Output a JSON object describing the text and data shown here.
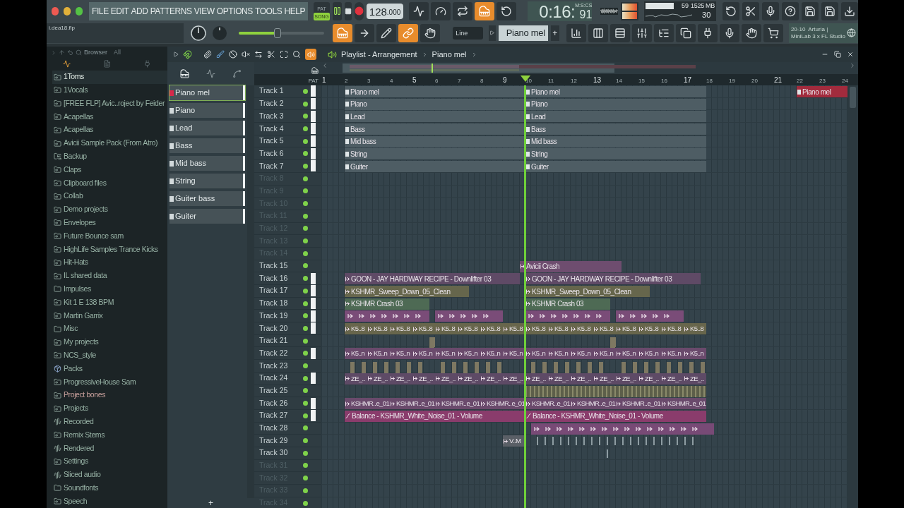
{
  "menu": [
    "FILE",
    "EDIT",
    "ADD",
    "PATTERNS",
    "VIEW",
    "OPTIONS",
    "TOOLS",
    "HELP"
  ],
  "transport": {
    "modes": [
      {
        "label": "PAT",
        "selected": false
      },
      {
        "label": "SONG",
        "selected": true
      }
    ],
    "tempo": "128",
    "tempo_fraction": ".000"
  },
  "time": {
    "main": "0:16:",
    "centiseconds": "91",
    "format": "M:S:CS"
  },
  "monitor": {
    "cpu": "59",
    "memory": "1525 MB",
    "polyphony": "30"
  },
  "hint": {
    "line1": "20-10  Arturia |",
    "line2": "MiniLab 3 x FL Studio"
  },
  "project_file": "i.dea18.flp",
  "master_volume": {
    "level": 0.45
  },
  "snap": "Line",
  "pattern": "Piano mel",
  "pattern_add": "+",
  "browser": {
    "title": "Browser",
    "filter": "All",
    "items": [
      {
        "label": "1Toms",
        "kind": "folder",
        "selected": true
      },
      {
        "label": "1Vocals",
        "kind": "folder",
        "selected": false
      },
      {
        "label": "[FREE FLP] Avic..roject by Feider",
        "kind": "folder",
        "selected": false
      },
      {
        "label": "Acapellas",
        "kind": "folder",
        "selected": false
      },
      {
        "label": "Acapellas",
        "kind": "folder",
        "selected": false
      },
      {
        "label": "Avicii Sample Pack (From Atro)",
        "kind": "folder",
        "selected": false
      },
      {
        "label": "Backup",
        "kind": "backup",
        "selected": false
      },
      {
        "label": "Claps",
        "kind": "folder",
        "selected": false
      },
      {
        "label": "Clipboard files",
        "kind": "folder",
        "selected": false
      },
      {
        "label": "Collab",
        "kind": "folder",
        "selected": false
      },
      {
        "label": "Demo projects",
        "kind": "folder",
        "selected": false
      },
      {
        "label": "Envelopes",
        "kind": "folder",
        "selected": false
      },
      {
        "label": "Future Bounce sam",
        "kind": "folder",
        "selected": false
      },
      {
        "label": "HighLife Samples Trance Kicks",
        "kind": "folder",
        "selected": false
      },
      {
        "label": "Hit-Hats",
        "kind": "folder",
        "selected": false
      },
      {
        "label": "IL shared data",
        "kind": "folder",
        "selected": false
      },
      {
        "label": "Impulses",
        "kind": "plain",
        "selected": false
      },
      {
        "label": "Kit 1 E 138 BPM",
        "kind": "folder",
        "selected": false
      },
      {
        "label": "Martin Garrix",
        "kind": "folder",
        "selected": false
      },
      {
        "label": "Misc",
        "kind": "plain",
        "selected": false
      },
      {
        "label": "My projects",
        "kind": "folder",
        "selected": false
      },
      {
        "label": "NCS_style",
        "kind": "folder",
        "selected": false
      },
      {
        "label": "Packs",
        "kind": "packs",
        "selected": false
      },
      {
        "label": "ProgressiveHouse Sam",
        "kind": "folder",
        "selected": false
      },
      {
        "label": "Project bones",
        "kind": "folder",
        "selected": false,
        "color": "#c8a09c"
      },
      {
        "label": "Projects",
        "kind": "folder",
        "selected": false
      },
      {
        "label": "Recorded",
        "kind": "audio",
        "selected": false
      },
      {
        "label": "Remix Stems",
        "kind": "folder",
        "selected": false
      },
      {
        "label": "Rendered",
        "kind": "audio",
        "selected": false
      },
      {
        "label": "Settings",
        "kind": "folder",
        "selected": false
      },
      {
        "label": "Sliced audio",
        "kind": "audio",
        "selected": false
      },
      {
        "label": "Soundfonts",
        "kind": "plain",
        "selected": false
      },
      {
        "label": "Speech",
        "kind": "folder",
        "selected": false
      }
    ]
  },
  "channels": {
    "items": [
      {
        "label": "Piano mel",
        "selected": true
      },
      {
        "label": "Piano",
        "selected": false
      },
      {
        "label": "Lead",
        "selected": false
      },
      {
        "label": "Bass",
        "selected": false
      },
      {
        "label": "Mid bass",
        "selected": false
      },
      {
        "label": "String",
        "selected": false
      },
      {
        "label": "Guiter bass",
        "selected": false
      },
      {
        "label": "Guiter",
        "selected": false
      }
    ],
    "add": "+"
  },
  "playlist": {
    "title": "Playlist - Arrangement",
    "pattern": "Piano mel",
    "pat_label": "PAT",
    "ruler": [
      "1",
      "2",
      "3",
      "4",
      "5",
      "6",
      "7",
      "8",
      "9",
      "10",
      "11",
      "12",
      "13",
      "14",
      "15",
      "16",
      "17",
      "18",
      "19",
      "20",
      "21",
      "22",
      "23",
      "24"
    ],
    "tracks": [
      {
        "name": "Track 1",
        "dimmed": false,
        "marked": true,
        "clips": [
          {
            "kind": "pattern",
            "label": "Piano mel",
            "color": "#4e5d64"
          },
          {
            "kind": "pattern",
            "label": "Piano mel",
            "color": "#4e5d64"
          },
          {
            "kind": "pattern",
            "label": "Piano mel",
            "color": "#a22b3d"
          }
        ]
      },
      {
        "name": "Track 2",
        "dimmed": false,
        "marked": true,
        "clips": [
          {
            "kind": "pattern",
            "label": "Piano",
            "color": "#4e5d64"
          },
          {
            "kind": "pattern",
            "label": "Piano",
            "color": "#4e5d64"
          }
        ]
      },
      {
        "name": "Track 3",
        "dimmed": false,
        "marked": true,
        "clips": [
          {
            "kind": "pattern",
            "label": "Lead",
            "color": "#4e5d64"
          },
          {
            "kind": "pattern",
            "label": "Lead",
            "color": "#4e5d64"
          }
        ]
      },
      {
        "name": "Track 4",
        "dimmed": false,
        "marked": true,
        "clips": [
          {
            "kind": "pattern",
            "label": "Bass",
            "color": "#4e5d64"
          },
          {
            "kind": "pattern",
            "label": "Bass",
            "color": "#4e5d64"
          }
        ]
      },
      {
        "name": "Track 5",
        "dimmed": false,
        "marked": true,
        "clips": [
          {
            "kind": "pattern",
            "label": "Mid bass",
            "color": "#4e5d64"
          },
          {
            "kind": "pattern",
            "label": "Mid bass",
            "color": "#4e5d64"
          }
        ]
      },
      {
        "name": "Track 6",
        "dimmed": false,
        "marked": true,
        "clips": [
          {
            "kind": "pattern",
            "label": "String",
            "color": "#4e5d64"
          },
          {
            "kind": "pattern",
            "label": "String",
            "color": "#4e5d64"
          }
        ]
      },
      {
        "name": "Track 7",
        "dimmed": false,
        "marked": true,
        "clips": [
          {
            "kind": "pattern",
            "label": "Guiter",
            "color": "#4e5d64"
          },
          {
            "kind": "pattern",
            "label": "Guiter",
            "color": "#4e5d64"
          }
        ]
      },
      {
        "name": "Track 8",
        "dimmed": true,
        "marked": false
      },
      {
        "name": "Track 9",
        "dimmed": true,
        "marked": false
      },
      {
        "name": "Track 10",
        "dimmed": true,
        "marked": false
      },
      {
        "name": "Track 11",
        "dimmed": true,
        "marked": false
      },
      {
        "name": "Track 12",
        "dimmed": true,
        "marked": false
      },
      {
        "name": "Track 13",
        "dimmed": true,
        "marked": false
      },
      {
        "name": "Track 14",
        "dimmed": true,
        "marked": false
      },
      {
        "name": "Track 15",
        "dimmed": false,
        "marked": false,
        "clips": [
          {
            "kind": "audio",
            "label": "Avicii Crash",
            "color": "#6e4d6f"
          }
        ]
      },
      {
        "name": "Track 16",
        "dimmed": false,
        "marked": true,
        "clips": [
          {
            "kind": "audio",
            "label": "GOON - JAY HARDWAY RECIPE - Downlifter 03",
            "color": "#5f4a66"
          },
          {
            "kind": "audio",
            "label": "GOON - JAY HARDWAY RECIPE - Downlifter 03",
            "color": "#5f4a66"
          }
        ]
      },
      {
        "name": "Track 17",
        "dimmed": false,
        "marked": true,
        "clips": [
          {
            "kind": "audio",
            "label": "KSHMR_Sweep_Down_05_Clean",
            "color": "#66664c"
          },
          {
            "kind": "audio",
            "label": "KSHMR_Sweep_Down_05_Clean",
            "color": "#66664c"
          }
        ]
      },
      {
        "name": "Track 18",
        "dimmed": false,
        "marked": true,
        "clips": [
          {
            "kind": "audio",
            "label": "KSHMR Crash 03",
            "color": "#4e6a54"
          },
          {
            "kind": "audio",
            "label": "KSHMR Crash 03",
            "color": "#4e6a54"
          }
        ]
      },
      {
        "name": "Track 19",
        "dimmed": false,
        "marked": true,
        "clips": [
          {
            "kind": "notes",
            "color": "#7a4c78"
          },
          {
            "kind": "notes",
            "color": "#7a4c78"
          },
          {
            "kind": "notes",
            "color": "#7a4c78"
          },
          {
            "kind": "notes",
            "color": "#7a4c78"
          }
        ]
      },
      {
        "name": "Track 20",
        "dimmed": false,
        "marked": true,
        "clips": [
          {
            "kind": "audio",
            "label": "K5..8",
            "color": "#68664c"
          },
          {
            "kind": "audio",
            "label": "K5..8",
            "color": "#68664c"
          },
          {
            "kind": "audio",
            "label": "K5..8",
            "color": "#68664c"
          },
          {
            "kind": "audio",
            "label": "K5..8",
            "color": "#68664c"
          },
          {
            "kind": "audio",
            "label": "K5..8",
            "color": "#68664c"
          },
          {
            "kind": "audio",
            "label": "K5..8",
            "color": "#68664c"
          },
          {
            "kind": "audio",
            "label": "K5..8",
            "color": "#68664c"
          },
          {
            "kind": "audio",
            "label": "K5..8",
            "color": "#68664c"
          },
          {
            "kind": "audio",
            "label": "K5..8",
            "color": "#68664c"
          },
          {
            "kind": "audio",
            "label": "K5..8",
            "color": "#68664c"
          },
          {
            "kind": "audio",
            "label": "K5..8",
            "color": "#68664c"
          },
          {
            "kind": "audio",
            "label": "K5..8",
            "color": "#68664c"
          },
          {
            "kind": "audio",
            "label": "K5..8",
            "color": "#68664c"
          },
          {
            "kind": "audio",
            "label": "K5..8",
            "color": "#68664c"
          },
          {
            "kind": "audio",
            "label": "K5..8",
            "color": "#68664c"
          },
          {
            "kind": "audio",
            "label": "K5..8",
            "color": "#68664c"
          }
        ]
      },
      {
        "name": "Track 21",
        "dimmed": false,
        "marked": false,
        "clips": [
          {
            "kind": "blip",
            "color": "#7e7862"
          },
          {
            "kind": "blip",
            "color": "#7e7862"
          }
        ]
      },
      {
        "name": "Track 22",
        "dimmed": false,
        "marked": true,
        "clips": [
          {
            "kind": "audio",
            "label": "K5..n",
            "color": "#6a4a6c"
          },
          {
            "kind": "audio",
            "label": "K5..n",
            "color": "#6a4a6c"
          },
          {
            "kind": "audio",
            "label": "K5..n",
            "color": "#6a4a6c"
          },
          {
            "kind": "audio",
            "label": "K5..n",
            "color": "#6a4a6c"
          },
          {
            "kind": "audio",
            "label": "K5..n",
            "color": "#6a4a6c"
          },
          {
            "kind": "audio",
            "label": "K5..n",
            "color": "#6a4a6c"
          },
          {
            "kind": "audio",
            "label": "K5..n",
            "color": "#6a4a6c"
          },
          {
            "kind": "audio",
            "label": "K5..n",
            "color": "#6a4a6c"
          },
          {
            "kind": "audio",
            "label": "K5..n",
            "color": "#6a4a6c"
          },
          {
            "kind": "audio",
            "label": "K5..n",
            "color": "#6a4a6c"
          },
          {
            "kind": "audio",
            "label": "K5..n",
            "color": "#6a4a6c"
          },
          {
            "kind": "audio",
            "label": "K5..n",
            "color": "#6a4a6c"
          },
          {
            "kind": "audio",
            "label": "K5..n",
            "color": "#6a4a6c"
          },
          {
            "kind": "audio",
            "label": "K5..n",
            "color": "#6a4a6c"
          },
          {
            "kind": "audio",
            "label": "K5..n",
            "color": "#6a4a6c"
          },
          {
            "kind": "audio",
            "label": "K5..n",
            "color": "#6a4a6c"
          }
        ]
      },
      {
        "name": "Track 23",
        "dimmed": false,
        "marked": false,
        "clips": [
          {
            "kind": "blip",
            "color": "#7e7862"
          },
          {
            "kind": "blip",
            "color": "#7e7862"
          },
          {
            "kind": "blip",
            "color": "#7e7862"
          },
          {
            "kind": "blip",
            "color": "#7e7862"
          },
          {
            "kind": "blip",
            "color": "#7e7862"
          },
          {
            "kind": "blip",
            "color": "#7e7862"
          },
          {
            "kind": "blip",
            "color": "#7e7862"
          },
          {
            "kind": "blip",
            "color": "#7e7862"
          },
          {
            "kind": "blip",
            "color": "#7e7862"
          },
          {
            "kind": "blip",
            "color": "#7e7862"
          },
          {
            "kind": "blip",
            "color": "#7e7862"
          },
          {
            "kind": "blip",
            "color": "#7e7862"
          },
          {
            "kind": "blip",
            "color": "#7e7862"
          },
          {
            "kind": "blip",
            "color": "#7e7862"
          },
          {
            "kind": "blip",
            "color": "#7e7862"
          },
          {
            "kind": "blip",
            "color": "#7e7862"
          },
          {
            "kind": "blip",
            "color": "#7e7862"
          },
          {
            "kind": "blip",
            "color": "#7e7862"
          },
          {
            "kind": "blip",
            "color": "#7e7862"
          },
          {
            "kind": "blip",
            "color": "#7e7862"
          },
          {
            "kind": "blip",
            "color": "#7e7862"
          },
          {
            "kind": "blip",
            "color": "#7e7862"
          },
          {
            "kind": "blip",
            "color": "#7e7862"
          },
          {
            "kind": "blip",
            "color": "#7e7862"
          },
          {
            "kind": "blip",
            "color": "#7e7862"
          },
          {
            "kind": "blip",
            "color": "#7e7862"
          },
          {
            "kind": "blip",
            "color": "#7e7862"
          },
          {
            "kind": "blip",
            "color": "#7e7862"
          }
        ]
      },
      {
        "name": "Track 24",
        "dimmed": false,
        "marked": true,
        "clips": [
          {
            "kind": "audio",
            "label": "ZE_..",
            "color": "#5e4a66"
          },
          {
            "kind": "audio",
            "label": "ZE_..",
            "color": "#5e4a66"
          },
          {
            "kind": "audio",
            "label": "ZE_..",
            "color": "#5e4a66"
          },
          {
            "kind": "audio",
            "label": "ZE_..",
            "color": "#5e4a66"
          },
          {
            "kind": "audio",
            "label": "ZE_..",
            "color": "#5e4a66"
          },
          {
            "kind": "audio",
            "label": "ZE_..",
            "color": "#5e4a66"
          },
          {
            "kind": "audio",
            "label": "ZE_..",
            "color": "#5e4a66"
          },
          {
            "kind": "audio",
            "label": "ZE_..",
            "color": "#5e4a66"
          },
          {
            "kind": "audio",
            "label": "ZE_..",
            "color": "#5e4a66"
          },
          {
            "kind": "audio",
            "label": "ZE_..",
            "color": "#5e4a66"
          },
          {
            "kind": "audio",
            "label": "ZE_..",
            "color": "#5e4a66"
          },
          {
            "kind": "audio",
            "label": "ZE_..",
            "color": "#5e4a66"
          },
          {
            "kind": "audio",
            "label": "ZE_..",
            "color": "#5e4a66"
          },
          {
            "kind": "audio",
            "label": "ZE_..",
            "color": "#5e4a66"
          },
          {
            "kind": "audio",
            "label": "ZE_..",
            "color": "#5e4a66"
          },
          {
            "kind": "audio",
            "label": "ZE_..",
            "color": "#5e4a66"
          }
        ]
      },
      {
        "name": "Track 25",
        "dimmed": false,
        "marked": false,
        "clips": [
          {
            "kind": "stripes",
            "color": "#5d5f4a"
          }
        ]
      },
      {
        "name": "Track 26",
        "dimmed": false,
        "marked": true,
        "clips": [
          {
            "kind": "audio",
            "label": "KSHMR..e_01",
            "color": "#6a4a6c"
          },
          {
            "kind": "audio",
            "label": "KSHMR..e_01",
            "color": "#6a4a6c"
          },
          {
            "kind": "audio",
            "label": "KSHMR..e_01",
            "color": "#6a4a6c"
          },
          {
            "kind": "audio",
            "label": "KSHMR..e_01",
            "color": "#6a4a6c"
          },
          {
            "kind": "audio",
            "label": "KSHMR..e_01",
            "color": "#6a4a6c"
          },
          {
            "kind": "audio",
            "label": "KSHMR..e_01",
            "color": "#6a4a6c"
          },
          {
            "kind": "audio",
            "label": "KSHMR..e_01",
            "color": "#6a4a6c"
          },
          {
            "kind": "audio",
            "label": "KSHMR..e_01",
            "color": "#6a4a6c"
          }
        ]
      },
      {
        "name": "Track 27",
        "dimmed": false,
        "marked": true,
        "clips": [
          {
            "kind": "automation",
            "label": "Balance - KSHMR_White_Noise_01 - Volume",
            "color": "#8a3c6c"
          },
          {
            "kind": "automation",
            "label": "Balance - KSHMR_White_Noise_01 - Volume",
            "color": "#8a3c6c"
          }
        ]
      },
      {
        "name": "Track 28",
        "dimmed": false,
        "marked": false,
        "clips": [
          {
            "kind": "notes",
            "color": "#784a76"
          }
        ]
      },
      {
        "name": "Track 29",
        "dimmed": false,
        "marked": false,
        "clips": [
          {
            "kind": "audio",
            "label": "V..M",
            "color": "#5a5f66"
          },
          {
            "kind": "ticks",
            "color": "#8e9ca2"
          }
        ]
      },
      {
        "name": "Track 30",
        "dimmed": false,
        "marked": false,
        "clips": [
          {
            "kind": "ticks",
            "color": "#8e9ca2"
          }
        ]
      },
      {
        "name": "Track 31",
        "dimmed": true,
        "marked": false
      },
      {
        "name": "Track 32",
        "dimmed": true,
        "marked": false
      },
      {
        "name": "Track 33",
        "dimmed": true,
        "marked": false
      },
      {
        "name": "Track 34",
        "dimmed": true,
        "marked": false
      }
    ]
  }
}
